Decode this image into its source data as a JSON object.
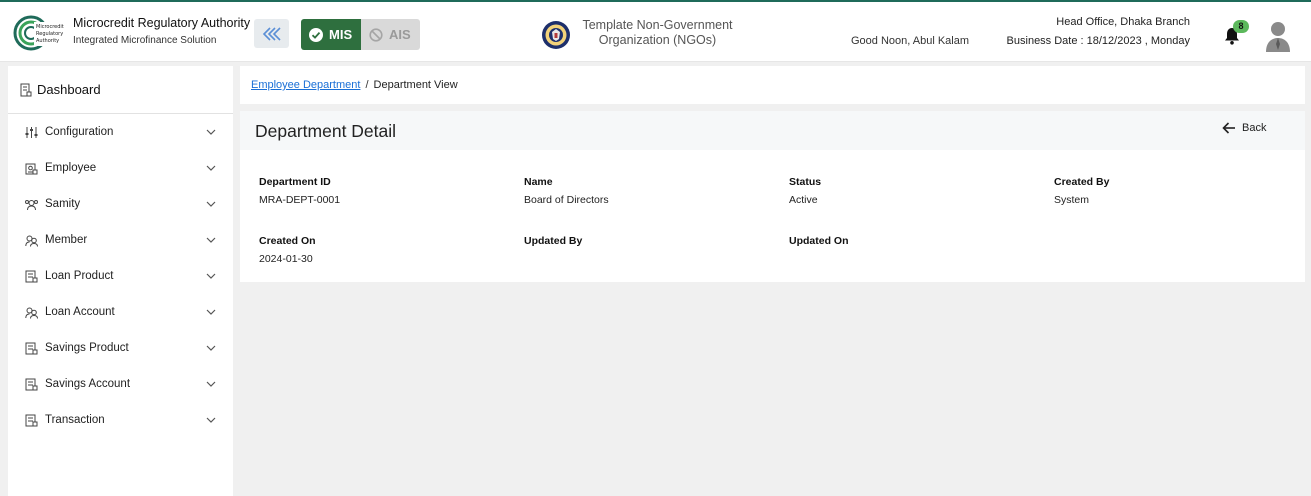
{
  "header": {
    "app_title": "Microcredit Regulatory Authority",
    "app_subtitle": "Integrated Microfinance Solution",
    "logo_text": "Microcredit Regulatory Authority",
    "modes": [
      {
        "label": "MIS",
        "active": true
      },
      {
        "label": "AIS",
        "active": false
      }
    ],
    "org_name_line1": "Template Non-Government",
    "org_name_line2": "Organization (NGOs)",
    "greeting": "Good Noon, Abul Kalam",
    "branch": "Head Office, Dhaka Branch",
    "business_date": "Business Date : 18/12/2023 , Monday",
    "notification_count": "8",
    "colors": {
      "brand": "#1f6b5a",
      "mis_active": "#2e6f3e",
      "badge": "#5cb85c"
    }
  },
  "sidebar": {
    "dashboard_label": "Dashboard",
    "items": [
      {
        "label": "Configuration",
        "icon": "sliders-icon"
      },
      {
        "label": "Employee",
        "icon": "employee-icon"
      },
      {
        "label": "Samity",
        "icon": "group-icon"
      },
      {
        "label": "Member",
        "icon": "members-icon"
      },
      {
        "label": "Loan Product",
        "icon": "document-icon"
      },
      {
        "label": "Loan Account",
        "icon": "members-icon"
      },
      {
        "label": "Savings Product",
        "icon": "document-icon"
      },
      {
        "label": "Savings Account",
        "icon": "document-icon"
      },
      {
        "label": "Transaction",
        "icon": "document-icon"
      }
    ]
  },
  "breadcrumb": {
    "parent": "Employee Department",
    "separator": "/",
    "current": "Department View"
  },
  "detail": {
    "title": "Department Detail",
    "back_label": "Back",
    "fields": [
      {
        "label": "Department ID",
        "value": "MRA-DEPT-0001"
      },
      {
        "label": "Name",
        "value": "Board of Directors"
      },
      {
        "label": "Status",
        "value": "Active"
      },
      {
        "label": "Created By",
        "value": "System"
      },
      {
        "label": "Created On",
        "value": "2024-01-30"
      },
      {
        "label": "Updated By",
        "value": ""
      },
      {
        "label": "Updated On",
        "value": ""
      }
    ]
  }
}
